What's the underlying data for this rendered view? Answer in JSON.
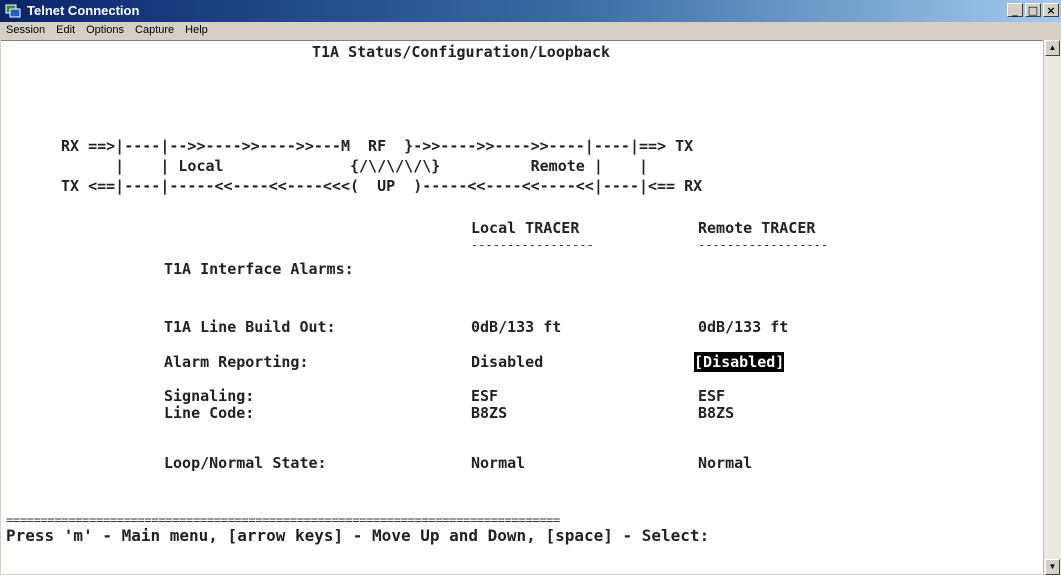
{
  "window": {
    "title": "Telnet Connection"
  },
  "menu": [
    "Session",
    "Edit",
    "Options",
    "Capture",
    "Help"
  ],
  "terminal": {
    "header": "T1A Status/Configuration/Loopback",
    "diagram": {
      "line1": "RX ==>|----|-->>---->>---->>---M  RF  }->>---->>---->>----|----|==> TX",
      "line2": "      |    | Local              {/\\/\\/\\/\\}          Remote |    |",
      "line3": "TX <==|----|-----<<----<<----<<<(  UP  )-----<<----<<----<<|----|<== RX"
    },
    "columns": {
      "local": "Local TRACER",
      "remote": "Remote TRACER"
    },
    "rows": [
      {
        "label": "T1A Interface Alarms:",
        "local": "",
        "remote": ""
      },
      {
        "label": "T1A Line Build Out:",
        "local": "0dB/133 ft",
        "remote": "0dB/133 ft"
      },
      {
        "label": "Alarm Reporting:",
        "local": "Disabled",
        "remote": "[Disabled]"
      },
      {
        "label": "Signaling:",
        "local": "ESF",
        "remote": "ESF"
      },
      {
        "label": "Line Code:",
        "local": "B8ZS",
        "remote": "B8ZS"
      },
      {
        "label": "Loop/Normal State:",
        "local": "Normal",
        "remote": "Normal"
      }
    ],
    "separator": "================================================================================",
    "footer": "Press 'm' - Main menu, [arrow keys] - Move Up and Down, [space] - Select:"
  }
}
